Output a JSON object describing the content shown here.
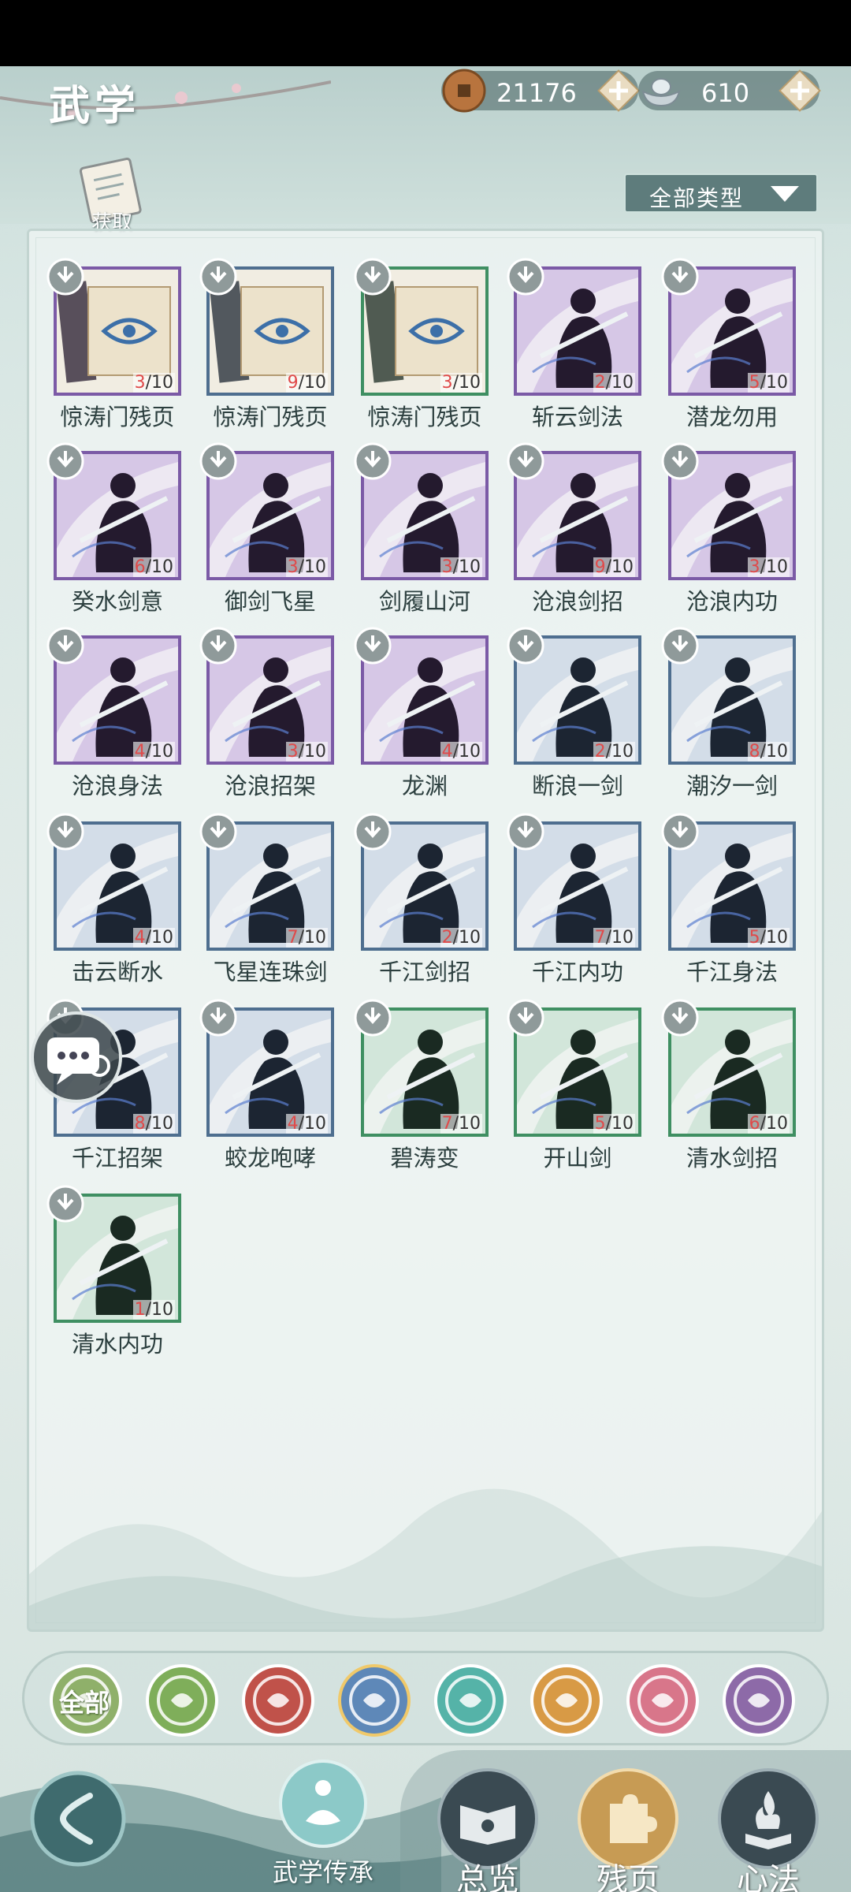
{
  "header": {
    "title": "武学",
    "coins": {
      "value": "21176",
      "icon": "copper-coin-icon"
    },
    "silver": {
      "value": "610",
      "icon": "silver-ingot-icon"
    },
    "get_label": "获取",
    "filter_label": "全部类型"
  },
  "cards": [
    {
      "name": "惊涛门残页",
      "have": "3",
      "total": "/10",
      "rarity": "purple",
      "art": "scroll"
    },
    {
      "name": "惊涛门残页",
      "have": "9",
      "total": "/10",
      "rarity": "blue",
      "art": "scroll"
    },
    {
      "name": "惊涛门残页",
      "have": "3",
      "total": "/10",
      "rarity": "green",
      "art": "scroll"
    },
    {
      "name": "斩云剑法",
      "have": "2",
      "total": "/10",
      "rarity": "purple",
      "art": "warrior"
    },
    {
      "name": "潜龙勿用",
      "have": "5",
      "total": "/10",
      "rarity": "purple",
      "art": "warrior"
    },
    {
      "name": "癸水剑意",
      "have": "6",
      "total": "/10",
      "rarity": "purple",
      "art": "warrior"
    },
    {
      "name": "御剑飞星",
      "have": "3",
      "total": "/10",
      "rarity": "purple",
      "art": "warrior"
    },
    {
      "name": "剑履山河",
      "have": "3",
      "total": "/10",
      "rarity": "purple",
      "art": "warrior"
    },
    {
      "name": "沧浪剑招",
      "have": "9",
      "total": "/10",
      "rarity": "purple",
      "art": "warrior"
    },
    {
      "name": "沧浪内功",
      "have": "3",
      "total": "/10",
      "rarity": "purple",
      "art": "warrior"
    },
    {
      "name": "沧浪身法",
      "have": "4",
      "total": "/10",
      "rarity": "purple",
      "art": "warrior"
    },
    {
      "name": "沧浪招架",
      "have": "3",
      "total": "/10",
      "rarity": "purple",
      "art": "warrior"
    },
    {
      "name": "龙渊",
      "have": "4",
      "total": "/10",
      "rarity": "purple",
      "art": "warrior"
    },
    {
      "name": "断浪一剑",
      "have": "2",
      "total": "/10",
      "rarity": "blue",
      "art": "warrior"
    },
    {
      "name": "潮汐一剑",
      "have": "8",
      "total": "/10",
      "rarity": "blue",
      "art": "warrior"
    },
    {
      "name": "击云断水",
      "have": "4",
      "total": "/10",
      "rarity": "blue",
      "art": "warrior"
    },
    {
      "name": "飞星连珠剑",
      "have": "7",
      "total": "/10",
      "rarity": "blue",
      "art": "warrior"
    },
    {
      "name": "千江剑招",
      "have": "2",
      "total": "/10",
      "rarity": "blue",
      "art": "warrior"
    },
    {
      "name": "千江内功",
      "have": "7",
      "total": "/10",
      "rarity": "blue",
      "art": "warrior"
    },
    {
      "name": "千江身法",
      "have": "5",
      "total": "/10",
      "rarity": "blue",
      "art": "warrior"
    },
    {
      "name": "千江招架",
      "have": "8",
      "total": "/10",
      "rarity": "blue",
      "art": "warrior"
    },
    {
      "name": "蛟龙咆哮",
      "have": "4",
      "total": "/10",
      "rarity": "blue",
      "art": "warrior"
    },
    {
      "name": "碧涛变",
      "have": "7",
      "total": "/10",
      "rarity": "green",
      "art": "warrior"
    },
    {
      "name": "开山剑",
      "have": "5",
      "total": "/10",
      "rarity": "green",
      "art": "warrior"
    },
    {
      "name": "清水剑招",
      "have": "6",
      "total": "/10",
      "rarity": "green",
      "art": "warrior"
    },
    {
      "name": "清水内功",
      "have": "1",
      "total": "/10",
      "rarity": "green",
      "art": "warrior"
    }
  ],
  "tabs": [
    {
      "label": "全部",
      "icon": "all-icon",
      "color": "#8fb06a"
    },
    {
      "icon": "bamboo-icon",
      "color": "#7fae5a"
    },
    {
      "icon": "flame-icon",
      "color": "#c0524a"
    },
    {
      "icon": "wave-icon",
      "color": "#5e88b8"
    },
    {
      "icon": "butterfly-icon",
      "color": "#55b3a8"
    },
    {
      "icon": "shield-icon",
      "color": "#d89a45"
    },
    {
      "icon": "crescent-icon",
      "color": "#d8768a"
    },
    {
      "icon": "rose-icon",
      "color": "#8d6aa8"
    }
  ],
  "bottom_nav": {
    "inherit_label": "武学传承",
    "overview_label": "总览",
    "fragments_label": "残页",
    "mind_label": "心法"
  },
  "colors": {
    "purple": "#7b5aa6",
    "blue": "#4e6e8f",
    "green": "#3f8f62",
    "count_have": "#e04a4a"
  }
}
